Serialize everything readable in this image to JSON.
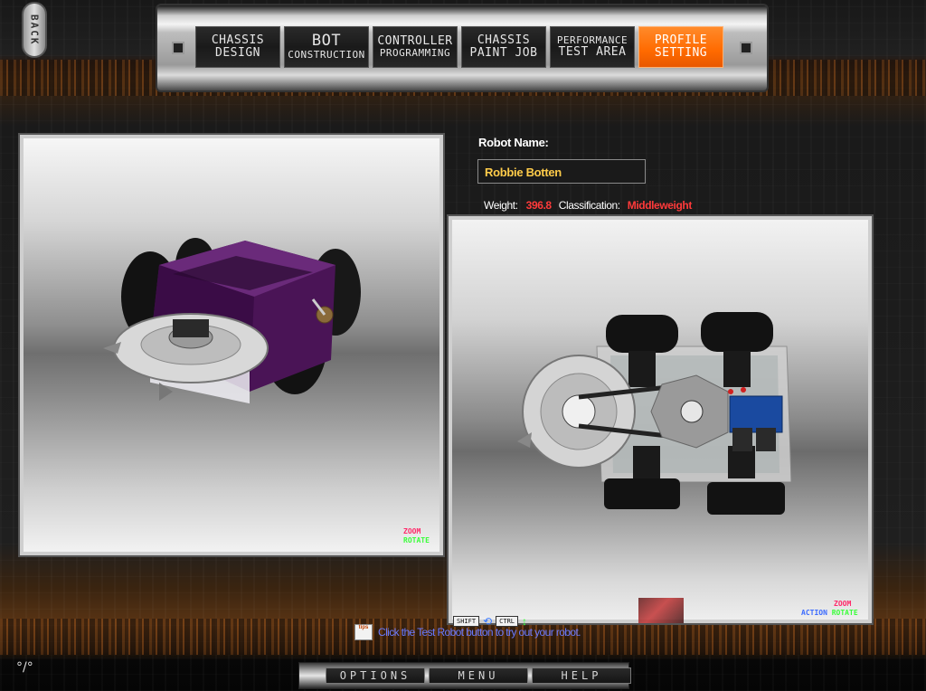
{
  "back_button": {
    "label": "BACK"
  },
  "nav": {
    "items": [
      {
        "line1": "CHASSIS",
        "line2": "DESIGN",
        "active": false
      },
      {
        "line1": "BOT",
        "line2": "CONSTRUCTION",
        "active": false
      },
      {
        "line1": "CONTROLLER",
        "line2": "PROGRAMMING",
        "active": false
      },
      {
        "line1": "CHASSIS",
        "line2": "PAINT JOB",
        "active": false
      },
      {
        "line1": "PERFORMANCE",
        "line2": "TEST AREA",
        "active": false
      },
      {
        "line1": "PROFILE",
        "line2": "SETTING",
        "active": true
      }
    ]
  },
  "profile": {
    "name_label": "Robot Name:",
    "name_value": "Robbie Botten",
    "weight_label": "Weight:",
    "weight_value": "396.8",
    "class_label": "Classification:",
    "class_value": "Middleweight"
  },
  "left_view": {
    "legend_zoom": "ZOOM",
    "legend_rotate": "ROTATE"
  },
  "right_view": {
    "legend_action": "ACTION",
    "legend_zoom": "ZOOM",
    "legend_rotate": "ROTATE",
    "key_shift": "SHIFT",
    "key_ctrl": "CTRL"
  },
  "tip": {
    "icon_text": "tips",
    "text": "Click the Test Robot button to try out your robot."
  },
  "bottom_menu": {
    "options": "OPTIONS",
    "menu": "MENU",
    "help": "HELP"
  },
  "colors": {
    "accent": "#ff6a00",
    "name_text": "#ffcc4a",
    "stat_value": "#ff3a3a",
    "robot_body": "#5a1a6a"
  }
}
